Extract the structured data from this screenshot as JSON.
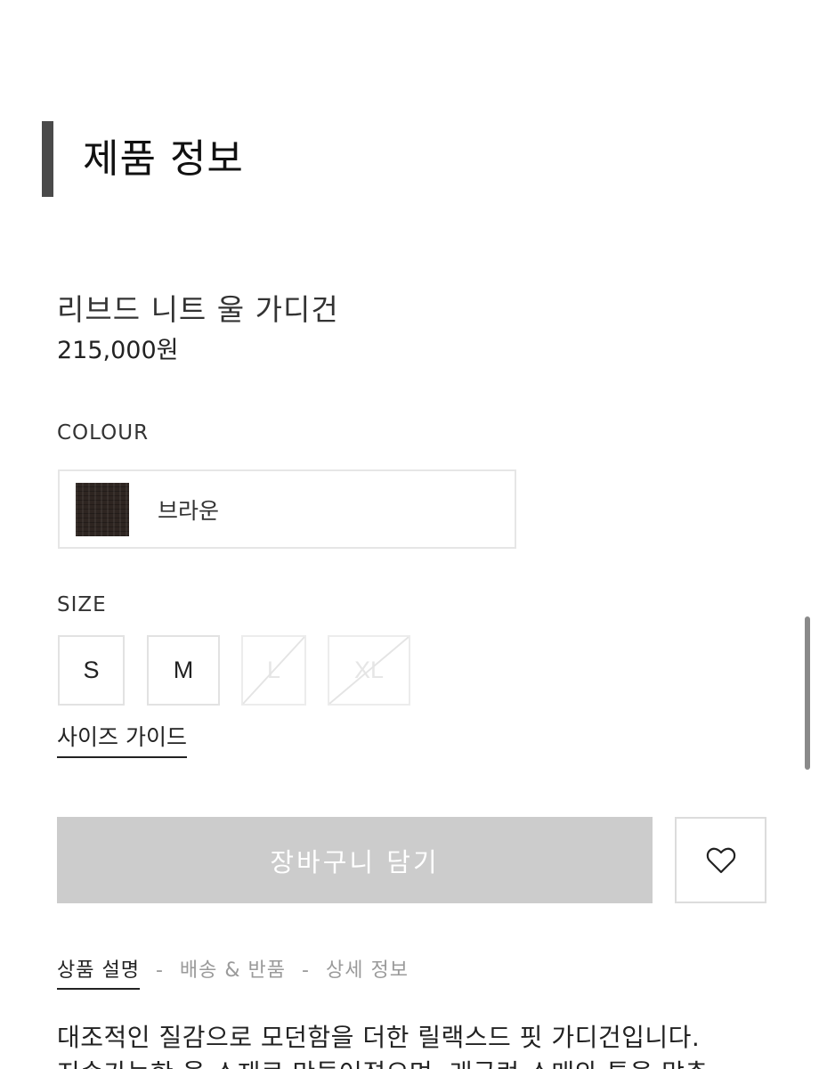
{
  "section": {
    "title": "제품 정보"
  },
  "product": {
    "name": "리브드 니트 울 가디건",
    "price": "215,000원"
  },
  "colour": {
    "label": "COLOUR",
    "selected_name": "브라운",
    "swatch_color": "#2e2521"
  },
  "size": {
    "label": "SIZE",
    "options": [
      {
        "label": "S",
        "available": true
      },
      {
        "label": "M",
        "available": true
      },
      {
        "label": "L",
        "available": false
      },
      {
        "label": "XL",
        "available": false
      }
    ],
    "guide_link": "사이즈 가이드"
  },
  "actions": {
    "cart_label": "장바구니 담기",
    "cart_color": "#cccccc",
    "wishlist_icon": "heart-icon"
  },
  "tabs": [
    {
      "label": "상품 설명",
      "active": true
    },
    {
      "label": "배송 & 반품",
      "active": false
    },
    {
      "label": "상세 정보",
      "active": false
    }
  ],
  "tab_separator": "-",
  "description": {
    "lines": [
      "대조적인 질감으로 모던함을 더한 릴랙스드 핏 가디건입니다.",
      "지속가능한 울 소재로 만들어졌으며, 래글런 소매와 톤을 맞춘"
    ]
  }
}
